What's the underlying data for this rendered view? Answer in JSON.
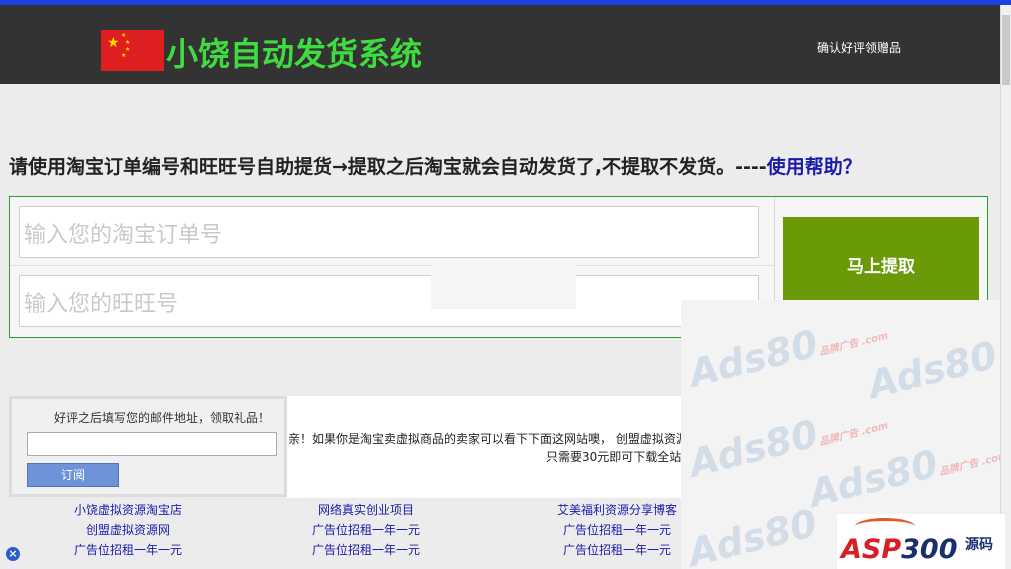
{
  "header": {
    "title": "小饶自动发货系统",
    "review_link": "确认好评领赠品"
  },
  "instruction": {
    "text": "请使用淘宝订单编号和旺旺号自助提货→提取之后淘宝就会自动发货了,不提取不发货。----",
    "help_link": "使用帮助？"
  },
  "form": {
    "order_placeholder": "输入您的淘宝订单号",
    "wangwang_placeholder": "输入您的旺旺号",
    "submit_label": "马上提取"
  },
  "gift": {
    "label": "好评之后填写您的邮件地址，领取礼品！",
    "subscribe_label": "订阅"
  },
  "promo": {
    "line1": "亲！如果你是淘宝卖虚拟商品的卖家可以看下下面这网站噢， 创盟虚拟资源",
    "line2": "只需要30元即可下载全站"
  },
  "links": {
    "col1": [
      "小饶虚拟资源淘宝店",
      "创盟虚拟资源网",
      "广告位招租一年一元"
    ],
    "col2": [
      "网络真实创业项目",
      "广告位招租一年一元",
      "广告位招租一年一元"
    ],
    "col3": [
      "艾美福利资源分享博客",
      "广告位招租一年一元",
      "广告位招租一年一元"
    ]
  },
  "watermark": {
    "text": "Ads80",
    "sub": "品牌广告 .com"
  },
  "asp_logo": {
    "text_red": "ASP",
    "text_blue": "300",
    "cn": "源码"
  },
  "colors": {
    "top_bar": "#1b3fe0",
    "header_bg": "#333333",
    "logo_green": "#3fdc3f",
    "submit_green": "#6a9a07",
    "form_border": "#2f9b2f",
    "link_blue": "#1b1baa"
  }
}
